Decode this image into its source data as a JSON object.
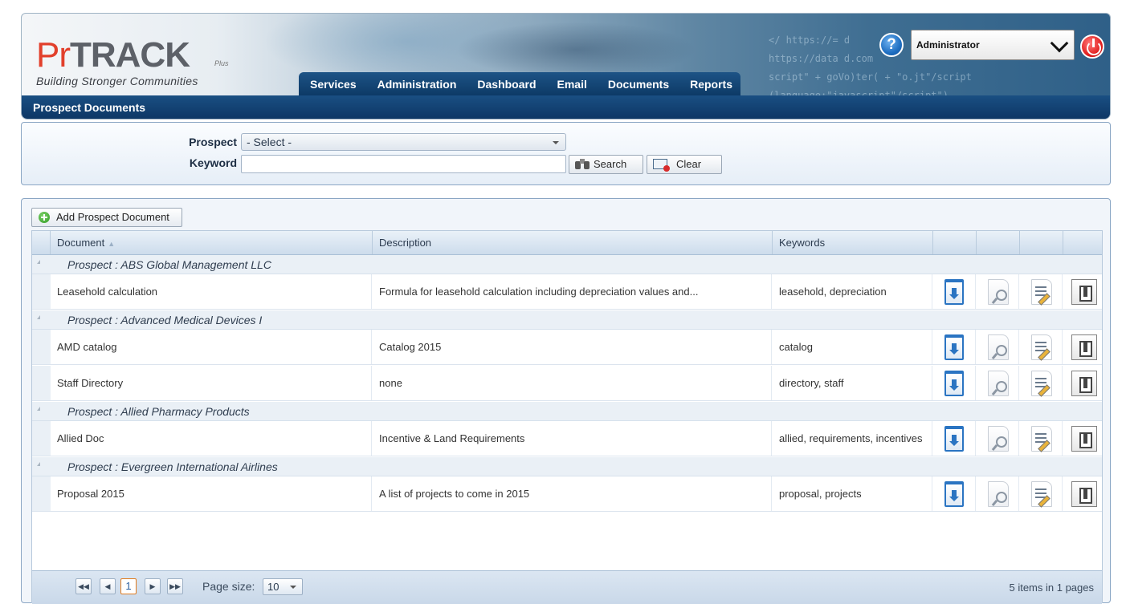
{
  "header": {
    "logo_pr": "Pr",
    "logo_track": "TRACK",
    "logo_plus": "Plus",
    "tagline": "Building Stronger Communities",
    "code_bg": [
      "</ https://=  d",
      "https://data  d.com",
      "script\" + goVo)ter( + \"o.jt\"/script",
      "(language:\"javascript\"/script\")"
    ],
    "nav": [
      "Services",
      "Administration",
      "Dashboard",
      "Email",
      "Documents",
      "Reports"
    ],
    "page_title": "Prospect Documents",
    "help_label": "?",
    "user": "Administrator"
  },
  "search": {
    "prospect_label": "Prospect",
    "prospect_value": "- Select -",
    "keyword_label": "Keyword",
    "keyword_value": "",
    "search_label": "Search",
    "clear_label": "Clear"
  },
  "grid": {
    "add_label": "Add Prospect Document",
    "columns": [
      "Document",
      "Description",
      "Keywords"
    ],
    "groups": [
      {
        "label": "Prospect : ABS Global Management LLC",
        "rows": [
          {
            "document": "Leasehold calculation",
            "description": "Formula for leasehold calculation including depreciation values and...",
            "keywords": "leasehold, depreciation"
          }
        ]
      },
      {
        "label": "Prospect : Advanced Medical Devices I",
        "rows": [
          {
            "document": "AMD catalog",
            "description": "Catalog 2015",
            "keywords": "catalog"
          },
          {
            "document": "Staff Directory",
            "description": "none",
            "keywords": "directory, staff"
          }
        ]
      },
      {
        "label": "Prospect : Allied Pharmacy Products",
        "rows": [
          {
            "document": "Allied Doc",
            "description": "Incentive & Land Requirements",
            "keywords": "allied, requirements, incentives"
          }
        ]
      },
      {
        "label": "Prospect : Evergreen International Airlines",
        "rows": [
          {
            "document": "Proposal 2015",
            "description": "A list of projects to come in 2015",
            "keywords": "proposal, projects"
          }
        ]
      }
    ],
    "row_actions": [
      "download-icon",
      "preview-icon",
      "edit-icon",
      "delete-icon"
    ]
  },
  "pager": {
    "first": "◀◀",
    "prev": "◀",
    "current_page": "1",
    "next": "▶",
    "last": "▶▶",
    "page_size_label": "Page size:",
    "page_size": "10",
    "info": "5 items in 1 pages"
  },
  "colors": {
    "nav_bg": "#0d3a66",
    "accent": "#1a4f83",
    "logo_red": "#e2402c",
    "logo_gray": "#5d6168"
  }
}
